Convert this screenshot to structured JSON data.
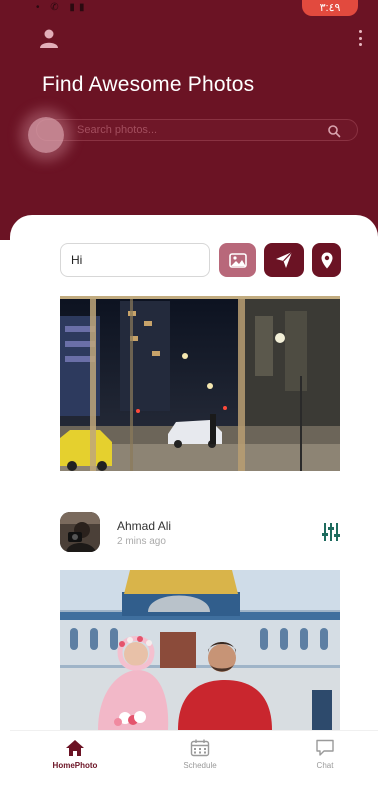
{
  "status_bar": {
    "time": "٣:٤٩"
  },
  "header": {
    "title": "Find Awesome Photos",
    "search_placeholder": "Search photos..."
  },
  "composer": {
    "message_value": "Hi"
  },
  "post": {
    "author": "Ahmad Ali",
    "time_ago": "2 mins ago"
  },
  "nav": {
    "items": [
      {
        "label": "HomePhoto",
        "icon": "home-icon",
        "active": true
      },
      {
        "label": "Schedule",
        "icon": "calendar-icon",
        "active": false
      },
      {
        "label": "Chat",
        "icon": "chat-icon",
        "active": false
      }
    ]
  },
  "colors": {
    "brand": "#6b1324",
    "image_button": "#b8687a",
    "filter_icon": "#1e6b5e"
  }
}
